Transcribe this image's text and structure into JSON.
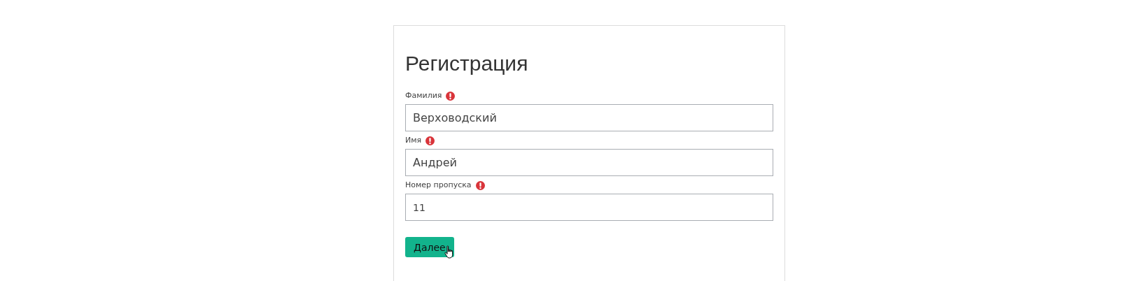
{
  "form": {
    "title": "Регистрация",
    "fields": [
      {
        "label": "Фамилия",
        "required": true,
        "value": "Верховодский",
        "kind": "text"
      },
      {
        "label": "Имя",
        "required": true,
        "value": "Андрей",
        "kind": "text"
      },
      {
        "label": "Номер пропуска",
        "required": true,
        "value": "11",
        "kind": "number"
      }
    ],
    "submit": {
      "label": "Далее",
      "hovered": true
    }
  }
}
